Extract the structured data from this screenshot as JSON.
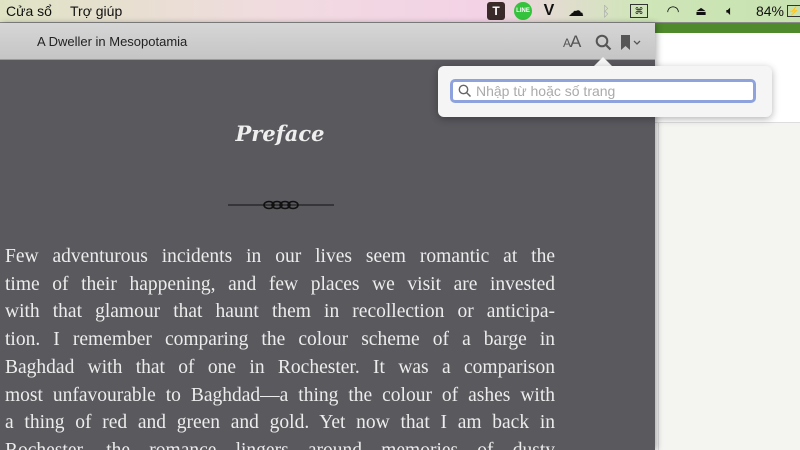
{
  "menubar": {
    "items": [
      "Cửa sổ",
      "Trợ giúp"
    ],
    "status": {
      "battery": "84%"
    }
  },
  "reader": {
    "title": "A Dweller in Mesopotamia",
    "font_size_label": "AA",
    "heading": "Preface",
    "lines": [
      "Few adventurous incidents in our lives seem romantic at the",
      "time of their happening, and few places we visit are invested",
      "with that glamour that haunt them in recollection or anticipa-",
      "tion. I remember comparing the colour scheme of a barge in",
      "Baghdad with that of one in Rochester. It was a comparison",
      "most unfavourable to Baghdad—a thing the colour of ashes with",
      "a thing of red and green and gold. Yet now that I am back in",
      "Rochester, the romance lingers around memories of dusty"
    ]
  },
  "search": {
    "placeholder": "Nhập từ hoặc số trang",
    "value": ""
  }
}
